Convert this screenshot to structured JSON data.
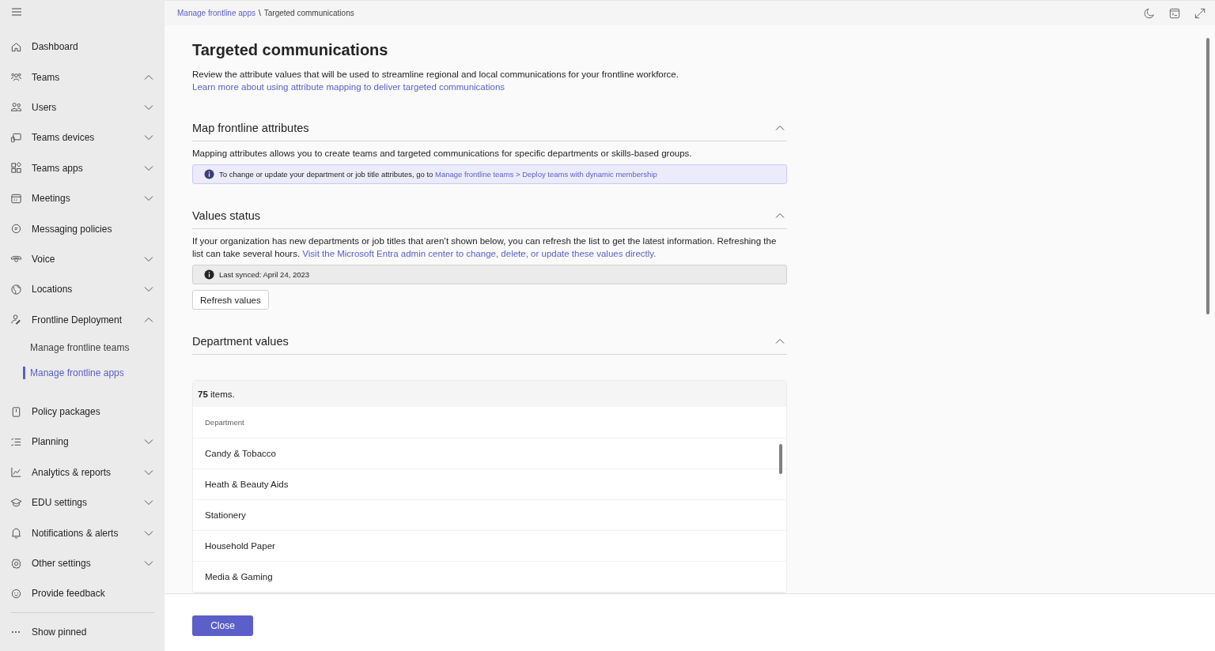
{
  "sidebar": {
    "items": [
      {
        "label": "Dashboard",
        "kind": "link"
      },
      {
        "label": "Teams",
        "kind": "group",
        "expanded": true
      },
      {
        "label": "Users",
        "kind": "group",
        "expanded": false
      },
      {
        "label": "Teams devices",
        "kind": "group",
        "expanded": false
      },
      {
        "label": "Teams apps",
        "kind": "group",
        "expanded": false
      },
      {
        "label": "Meetings",
        "kind": "group",
        "expanded": false
      },
      {
        "label": "Messaging policies",
        "kind": "link"
      },
      {
        "label": "Voice",
        "kind": "group",
        "expanded": false
      },
      {
        "label": "Locations",
        "kind": "group",
        "expanded": false
      },
      {
        "label": "Frontline Deployment",
        "kind": "group",
        "expanded": true,
        "children": [
          {
            "label": "Manage frontline teams",
            "selected": false
          },
          {
            "label": "Manage frontline apps",
            "selected": true
          }
        ]
      },
      {
        "label": "Policy packages",
        "kind": "link"
      },
      {
        "label": "Planning",
        "kind": "group",
        "expanded": false
      },
      {
        "label": "Analytics & reports",
        "kind": "group",
        "expanded": false
      },
      {
        "label": "EDU settings",
        "kind": "group",
        "expanded": false
      },
      {
        "label": "Notifications & alerts",
        "kind": "group",
        "expanded": false
      },
      {
        "label": "Other settings",
        "kind": "group",
        "expanded": false
      },
      {
        "label": "Provide feedback",
        "kind": "link"
      }
    ],
    "show_pinned": "Show pinned"
  },
  "breadcrumb": {
    "separator": "\\",
    "items": [
      {
        "label": "Manage frontline apps",
        "kind": "link"
      },
      {
        "label": "Targeted communications",
        "kind": "current"
      }
    ]
  },
  "page": {
    "title": "Targeted communications",
    "description": "Review the attribute values that will be used to streamline regional and local communications for your frontline workforce.",
    "learn_more_link": "Learn more about using attribute mapping to deliver targeted communications"
  },
  "sections": [
    {
      "kind": "map",
      "title": "Map frontline attributes",
      "expanded": true,
      "paragraph": "Mapping attributes allows you to create teams and targeted communications for specific departments or skills-based groups.",
      "notice": {
        "text": "To change or update your department or job title attributes, go to",
        "link": "Manage frontline teams > Deploy teams with dynamic membership"
      }
    },
    {
      "kind": "status",
      "title": "Values status",
      "expanded": true,
      "paragraph": "If your organization has new departments or job titles that aren’t shown below, you can refresh the list to get the latest information. Refreshing the list can take several hours.",
      "link": "Visit the Microsoft Entra admin center to change, delete, or update these values directly.",
      "notice": {
        "text": "Last synced: April 24, 2023"
      },
      "button": "Refresh values"
    },
    {
      "kind": "table",
      "title": "Department values",
      "expanded": true,
      "count": "**75** items.",
      "column": "Department",
      "rows": [
        "Candy & Tobacco",
        "Heath & Beauty Aids",
        "Stationery",
        "Household Paper",
        "Media & Gaming"
      ]
    }
  ],
  "footer": {
    "button": "Close"
  }
}
